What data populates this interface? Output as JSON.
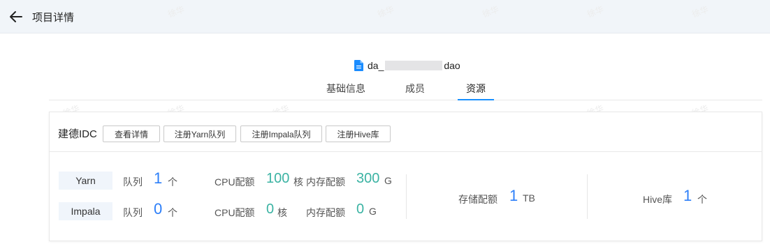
{
  "header": {
    "title": "项目详情"
  },
  "project": {
    "name_prefix": "da_",
    "name_suffix": "dao"
  },
  "tabs": [
    {
      "label": "基础信息",
      "active": false
    },
    {
      "label": "成员",
      "active": false
    },
    {
      "label": "资源",
      "active": true
    }
  ],
  "card": {
    "idc_name": "建德IDC",
    "buttons": {
      "details": "查看详情",
      "register_yarn": "注册Yarn队列",
      "register_impala": "注册Impala队列",
      "register_hive": "注册Hive库"
    },
    "yarn": {
      "label": "Yarn",
      "queue_label": "队列",
      "queue_value": "1",
      "queue_unit": "个",
      "cpu_label": "CPU配额",
      "cpu_value": "100",
      "cpu_unit": "核",
      "mem_label": "内存配额",
      "mem_value": "300",
      "mem_unit": "G"
    },
    "impala": {
      "label": "Impala",
      "queue_label": "队列",
      "queue_value": "0",
      "queue_unit": "个",
      "cpu_label": "CPU配额",
      "cpu_value": "0",
      "cpu_unit": "核",
      "mem_label": "内存配额",
      "mem_value": "0",
      "mem_unit": "G"
    },
    "storage": {
      "label": "存储配额",
      "value": "1",
      "unit": "TB"
    },
    "hive": {
      "label": "Hive库",
      "value": "1",
      "unit": "个"
    }
  },
  "watermark": "徐华",
  "colors": {
    "accent": "#1890ff",
    "number_blue": "#2d7ff9",
    "number_teal": "#3bb3a3",
    "header_bg": "#f1f5f9"
  }
}
